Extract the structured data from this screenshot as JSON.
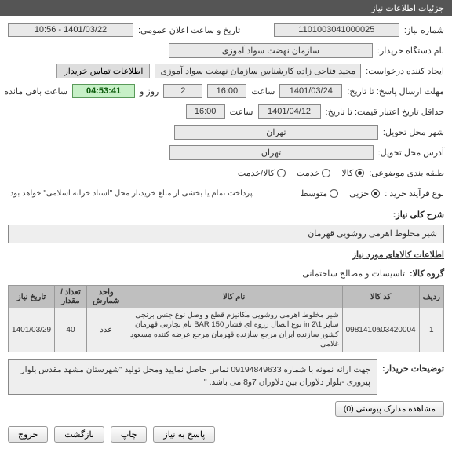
{
  "header": {
    "title": "جزئیات اطلاعات نیاز"
  },
  "form": {
    "need_no_label": "شماره نیاز:",
    "need_no": "1101003041000025",
    "announce_label": "تاریخ و ساعت اعلان عمومی:",
    "announce": "1401/03/22 - 10:56",
    "buyer_label": "نام دستگاه خریدار:",
    "buyer": "سازمان نهضت سواد آموزی",
    "creator_label": "ایجاد کننده درخواست:",
    "creator": "مجید فتاحی زاده کارشناس سازمان نهضت سواد آموزی",
    "contact_btn": "اطلاعات تماس خریدار",
    "resp_deadline_label": "مهلت ارسال پاسخ: تا تاریخ:",
    "resp_date": "1401/03/24",
    "time_label": "ساعت",
    "resp_time": "16:00",
    "days_count": "2",
    "days_suffix": "روز و",
    "remain_time": "04:53:41",
    "remain_suffix": "ساعت باقی مانده",
    "valid_deadline_label": "حداقل تاریخ اعتبار قیمت: تا تاریخ:",
    "valid_date": "1401/04/12",
    "valid_time": "16:00",
    "delivery_city_label": "شهر محل تحویل:",
    "delivery_city": "تهران",
    "delivery_addr_label": "آدرس محل تحویل:",
    "delivery_addr": "تهران",
    "category_label": "طبقه بندی موضوعی:",
    "radios": {
      "kala": "کالا",
      "khadmat": "خدمت",
      "kalakhadmat": "کالا/خدمت"
    },
    "process_type_label": "نوع فرآیند خرید :",
    "process_note": "پرداخت تمام یا بخشی از مبلغ خرید،از محل \"اسناد خزانه اسلامی\" خواهد بود.",
    "proc_radios": {
      "jozi": "جزیی",
      "motavasset": "متوسط"
    }
  },
  "need_title_label": "شرح کلی نیاز:",
  "need_title": "شیر مخلوط اهرمی روشویی قهرمان",
  "required_items_title": "اطلاعات کالاهای مورد نیاز",
  "group_label": "گروه کالا:",
  "group_value": "تاسیسات و مصالح ساختمانی",
  "table": {
    "headers": {
      "row": "ردیف",
      "code": "کد کالا",
      "name": "نام کالا",
      "unit": "واحد شمارش",
      "qty": "تعداد / مقدار",
      "date": "تاریخ نیاز"
    },
    "rows": [
      {
        "row": "1",
        "code": "0981410a03420004",
        "name": "شیر مخلوط اهرمی روشویی مکانیزم قطع و وصل نوع جنس برنجی سایز in 2\\1 نوع اتصال رزوه ای فشار BAR 150 نام تجارتی قهرمان کشور سازنده ایران مرجع سازنده قهرمان مرجع عرضه کننده مسعود غلامی",
        "unit": "عدد",
        "qty": "40",
        "date": "1401/03/29"
      }
    ]
  },
  "buyer_desc_label": "توضیحات خریدار:",
  "buyer_desc": "جهت ارائه نمونه با شماره 09194849633 تماس حاصل نمایید ومحل تولید \"شهرستان مشهد مقدس بلوار پیروزی -بلوار دلاوران بین دلاوران 7و8 می باشد. \"",
  "attach_btn": "مشاهده مدارک پیوستی (0)",
  "buttons": {
    "reply": "پاسخ به نیاز",
    "print": "چاپ",
    "back": "بازگشت",
    "exit": "خروج"
  }
}
